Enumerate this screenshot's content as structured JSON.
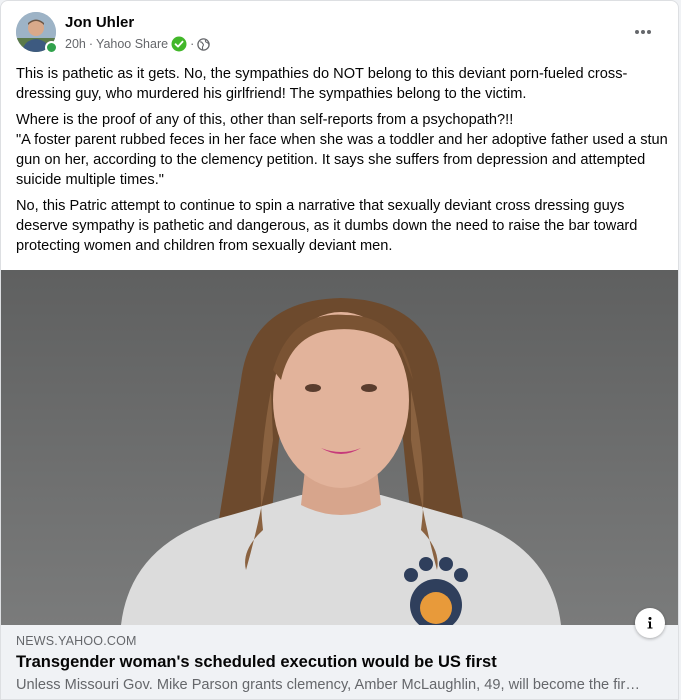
{
  "post": {
    "author": "Jon Uhler",
    "time": "20h",
    "separator1": "·",
    "source": "Yahoo Share",
    "separator2": "·",
    "paragraphs": [
      "This is pathetic as it gets. No, the sympathies do NOT belong to this deviant porn-fueled cross-dressing guy, who murdered his girlfriend! The sympathies belong to the victim.",
      "Where is the proof of any of this, other than self-reports from a psychopath?!!",
      "\"A foster parent rubbed feces in her face when she was a toddler and her adoptive father used a stun gun on her, according to the clemency petition. It says she suffers from depression and attempted suicide multiple times.\"",
      "No, this Patric attempt to continue to spin a narrative that sexually deviant cross dressing guys deserve sympathy is pathetic and dangerous, as it dumbs down the need to raise the bar toward protecting women and children from sexually deviant men."
    ]
  },
  "link_preview": {
    "domain": "NEWS.YAHOO.COM",
    "title": "Transgender woman's scheduled execution would be US first",
    "description": "Unless Missouri Gov. Mike Parson grants clemency, Amber McLaughlin, 49, will become the first openly transgender person executed in the U.S."
  },
  "icons": {
    "verified": "verified-badge-icon",
    "privacy": "globe-icon",
    "more": "more-options-icon",
    "info": "info-icon"
  },
  "colors": {
    "verified": "#42b72a",
    "online": "#31a24c",
    "secondary_text": "#65676b",
    "link_bg": "#f0f2f5"
  }
}
